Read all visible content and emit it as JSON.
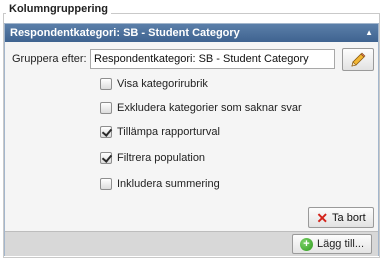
{
  "fieldset": {
    "legend": "Kolumngruppering"
  },
  "panel": {
    "title": "Respondentkategori: SB - Student Category",
    "collapse_icon": "chevron-up-icon"
  },
  "group_by": {
    "label": "Gruppera efter:",
    "value": "Respondentkategori: SB - Student Category",
    "edit_icon": "pencil-icon"
  },
  "options": [
    {
      "label": "Visa kategorirubrik",
      "checked": false
    },
    {
      "label": "Exkludera kategorier som saknar svar",
      "checked": false
    },
    {
      "label": "Tillämpa rapporturval",
      "checked": true
    },
    {
      "label": "Filtrera population",
      "checked": true
    },
    {
      "label": "Inkludera summering",
      "checked": false
    }
  ],
  "remove_button": {
    "label": "Ta bort",
    "icon": "close-icon",
    "icon_color": "#d4241b"
  },
  "add_button": {
    "label": "Lägg till...",
    "icon": "plus-icon",
    "icon_color": "#3aa824"
  },
  "colors": {
    "header": "#4a6f9c",
    "footer": "#d8d8d8"
  }
}
